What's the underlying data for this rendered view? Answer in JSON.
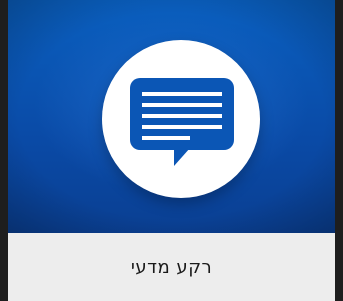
{
  "tile": {
    "title": "רקע מדעי",
    "icon": "chat-bubble-icon",
    "colors": {
      "image_background": "#0a4fae",
      "circle": "#ffffff",
      "icon": "#0b56b5",
      "caption_background": "#ededed",
      "caption_text": "#1a1a1a"
    }
  }
}
